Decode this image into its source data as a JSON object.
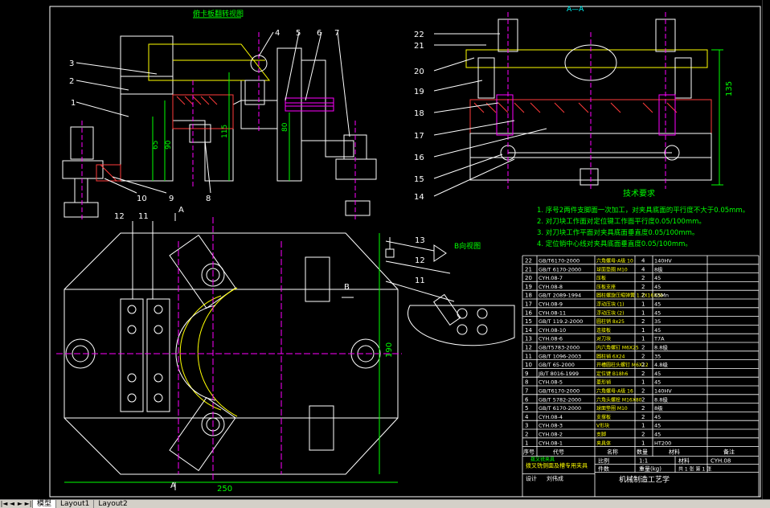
{
  "drawing": {
    "title_view": "俯卡板翻转视图",
    "section_label": "A—A",
    "view_b_label": "B向视图",
    "arrow_a": "A",
    "arrow_b": "B",
    "dim_left": [
      "65",
      "90",
      "115"
    ],
    "dim_mid": "80",
    "dim_right": "135",
    "dim_bottom": "250",
    "dim_side": "190",
    "callouts_left": [
      "1",
      "2",
      "3",
      "4",
      "5",
      "6",
      "7",
      "8",
      "9",
      "10",
      "11",
      "12"
    ],
    "callouts_right": [
      "22",
      "21",
      "20",
      "19",
      "18",
      "17",
      "16",
      "15",
      "14"
    ],
    "callouts_bview": [
      "13",
      "12",
      "11"
    ]
  },
  "tech": {
    "title": "技术要求",
    "lines": [
      "1. 序号2两件支脚面一次加工，对夹具底面的平行度不大于0.05mm。",
      "2. 对刀块工作面对定位键工作面平行度0.05/100mm。",
      "3. 对刀块工作平面对夹具底面垂直度0.05/100mm。",
      "4. 定位销中心线对夹具底面垂直度0.05/100mm。"
    ]
  },
  "bom": {
    "rows": [
      [
        "22",
        "GB/T6170-2000",
        "六角螺母-A级 10",
        "4",
        "140HV"
      ],
      [
        "21",
        "GB/T 6170-2000",
        "球面垫圈 M10",
        "4",
        "8级"
      ],
      [
        "20",
        "CYH.08-7",
        "压板",
        "2",
        "45"
      ],
      [
        "19",
        "CYH.08-8",
        "压板支座",
        "2",
        "45"
      ],
      [
        "18",
        "GB/T 2089-1994",
        "圆柱螺旋压缩弹簧 1.2X16X30",
        "2",
        "65Mn"
      ],
      [
        "17",
        "CYH.08-9",
        "浮动压块 (1)",
        "1",
        "45"
      ],
      [
        "16",
        "CYH.08-11",
        "浮动压块 (2)",
        "1",
        "45"
      ],
      [
        "15",
        "GB/T 119.2-2000",
        "圆柱销 8x25",
        "2",
        "35"
      ],
      [
        "14",
        "CYH.08-10",
        "连接板",
        "1",
        "45"
      ],
      [
        "13",
        "CYH.08-6",
        "对刀块",
        "1",
        "T7A"
      ],
      [
        "12",
        "GB/T5783-2000",
        "内六角螺钉 M6X25",
        "2",
        "8.8级"
      ],
      [
        "11",
        "GB/T 1096-2003",
        "圆柱销 6X24",
        "2",
        "35"
      ],
      [
        "10",
        "GB/T 65-2000",
        "开槽圆柱头螺钉 M6X12",
        "2",
        "4.8级"
      ],
      [
        "9",
        "JB/T 8016-1999",
        "定位键 B18h6",
        "2",
        "45"
      ],
      [
        "8",
        "CYH.08-5",
        "菱形销",
        "1",
        "45"
      ],
      [
        "7",
        "GB/T6170-2000",
        "六角螺母-A级 16",
        "2",
        "140HV"
      ],
      [
        "6",
        "GB/T 5782-2000",
        "六角头螺栓 M16X80",
        "2",
        "8.8级"
      ],
      [
        "5",
        "GB/T 6170-2000",
        "球面垫圈 M10",
        "2",
        "8级"
      ],
      [
        "4",
        "CYH.08-4",
        "支撑板",
        "2",
        "45"
      ],
      [
        "3",
        "CYH.08-3",
        "V形块",
        "1",
        "45"
      ],
      [
        "2",
        "CYH.08-2",
        "支脚",
        "2",
        "45"
      ],
      [
        "1",
        "CYH.08-1",
        "夹具体",
        "1",
        "HT200"
      ]
    ],
    "header": [
      "序号",
      "代号",
      "名称",
      "数量",
      "材料",
      "备注"
    ],
    "title_block": {
      "drawing_name": "拨叉铣夹具",
      "drawing_no": "CYH.08",
      "scale_label": "比例",
      "scale_value": "1:1",
      "count_label": "件数",
      "weight_label": "重量(kg)",
      "design_label": "设计",
      "designer": "刘伟成",
      "school": "机械制造工艺学",
      "desc": "拨叉铣侧面及槽专用夹具",
      "sheet": "共 1 张  第 1 张",
      "extra": "材料"
    }
  },
  "tabs": {
    "nav": [
      "|◄",
      "◄",
      "►",
      "►|"
    ],
    "items": [
      "模型",
      "Layout1",
      "Layout2"
    ],
    "active": 0
  },
  "colors": {
    "outline": "#ffffff",
    "hatch": "#ff3b3b",
    "center": "#ff00ff",
    "dim": "#00ff00",
    "label": "#00ff00",
    "yellow": "#ffff00",
    "cyan": "#00ffff"
  }
}
